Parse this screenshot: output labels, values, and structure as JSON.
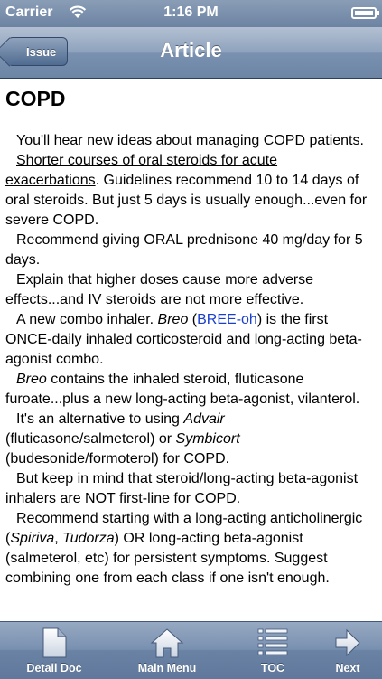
{
  "status_bar": {
    "carrier": "Carrier",
    "time": "1:16 PM"
  },
  "nav": {
    "back_label": "Issue",
    "title": "Article"
  },
  "article": {
    "title": "COPD",
    "p1_link": "new ideas about managing COPD patients",
    "p1_pre": "You'll hear ",
    "p1_post": ".",
    "p2_link": "Shorter courses of oral steroids for acute exacerbations",
    "p2_post": ". Guidelines recommend 10 to 14 days of oral steroids. But just 5 days is usually enough...even for severe COPD.",
    "p3": "Recommend giving ORAL prednisone 40 mg/day for 5 days.",
    "p4": "Explain that higher doses cause more adverse effects...and IV steroids are not more effective.",
    "p5_link": "A new combo inhaler",
    "p5_a": ". ",
    "p5_drug": "Breo",
    "p5_b": " (",
    "p5_pron": "BREE-oh",
    "p5_c": ") is the first ONCE-daily inhaled corticosteroid and long-acting beta-agonist combo.",
    "p6_drug": "Breo",
    "p6_rest": " contains the inhaled steroid, fluticasone furoate...plus a new long-acting beta-agonist, vilanterol.",
    "p7_a": "It's an alternative to using ",
    "p7_drug1": "Advair",
    "p7_b": " (fluticasone/salmeterol) or ",
    "p7_drug2": "Symbicort",
    "p7_c": " (budesonide/formoterol) for COPD.",
    "p8": "But keep in mind that steroid/long-acting beta-agonist inhalers are NOT first-line for COPD.",
    "p9_a": "Recommend starting with a long-acting anticholinergic (",
    "p9_drug1": "Spiriva",
    "p9_b": ", ",
    "p9_drug2": "Tudorza",
    "p9_c": ") OR long-acting beta-agonist (salmeterol, etc) for persistent symptoms. Suggest combining one from each class if one isn't enough."
  },
  "tabs": [
    {
      "label": "Detail Doc",
      "icon": "document-icon"
    },
    {
      "label": "Main Menu",
      "icon": "home-icon"
    },
    {
      "label": "TOC",
      "icon": "list-icon"
    },
    {
      "label": "Next",
      "icon": "arrow-right-icon"
    }
  ]
}
